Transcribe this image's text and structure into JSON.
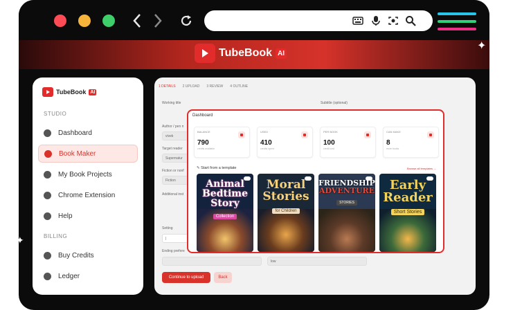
{
  "browser": {
    "nav_back": "<",
    "nav_forward": ">",
    "reload": "C"
  },
  "brand": {
    "name": "TubeBook",
    "ai": "AI"
  },
  "sidebar": {
    "brand_name": "TubeBook",
    "brand_ai": "AI",
    "sections": [
      {
        "label": "STUDIO",
        "items": [
          {
            "label": "Dashboard",
            "icon": "dashboard-icon",
            "active": false
          },
          {
            "label": "Book Maker",
            "icon": "magic-wand-icon",
            "active": true
          },
          {
            "label": "My Book Projects",
            "icon": "layers-icon",
            "active": false
          },
          {
            "label": "Chrome Extension",
            "icon": "chrome-icon",
            "active": false
          },
          {
            "label": "Help",
            "icon": "help-icon",
            "active": false
          }
        ]
      },
      {
        "label": "BILLING",
        "items": [
          {
            "label": "Buy Credits",
            "icon": "gem-icon",
            "active": false
          },
          {
            "label": "Ledger",
            "icon": "ledger-icon",
            "active": false
          }
        ]
      }
    ]
  },
  "form": {
    "steps": [
      "1 DETAILS",
      "2 UPLOAD",
      "3 REVIEW",
      "4 OUTLINE"
    ],
    "labels": {
      "working_title": "Working title",
      "subtitle": "Subtitle (optional)",
      "author": "Author / pen n",
      "target_reader": "Target reader",
      "fiction": "Fiction or nonf",
      "additional": "Additional inst",
      "setting": "Setting",
      "ending": "Ending prefere"
    },
    "values": {
      "author": "vivek",
      "target_reader": "Supernatur",
      "fiction": "Fiction",
      "setting": "|",
      "ending_right": "low"
    },
    "continue": "Continue to upload",
    "back": "Back"
  },
  "modal": {
    "title": "Dashboard",
    "stats": [
      {
        "label": "BALANCE",
        "value": "790",
        "sub": "credits available"
      },
      {
        "label": "USED",
        "value": "410",
        "sub": "credits spent"
      },
      {
        "label": "PER BOOK",
        "value": "100",
        "sub": "credit cost"
      },
      {
        "label": "CAN MAKE",
        "value": "8",
        "sub": "more books"
      }
    ],
    "templates_heading": "Start from a template",
    "templates_link": "Browse all templates →",
    "covers": [
      {
        "title_lines": [
          "Animal",
          "Bedtime",
          "Story"
        ],
        "small": "Collection"
      },
      {
        "title_lines": [
          "Moral",
          "Stories"
        ],
        "small": "for Children"
      },
      {
        "title_lines": [
          "FRIENDSHIP",
          "ADVENTURE"
        ],
        "small": "STORIES"
      },
      {
        "title_lines": [
          "Early",
          "Reader"
        ],
        "small": "Short Stories"
      }
    ]
  },
  "colors": {
    "accent": "#e22b2b",
    "frame": "#0b0b0b",
    "active_bg": "#fde8e6"
  }
}
